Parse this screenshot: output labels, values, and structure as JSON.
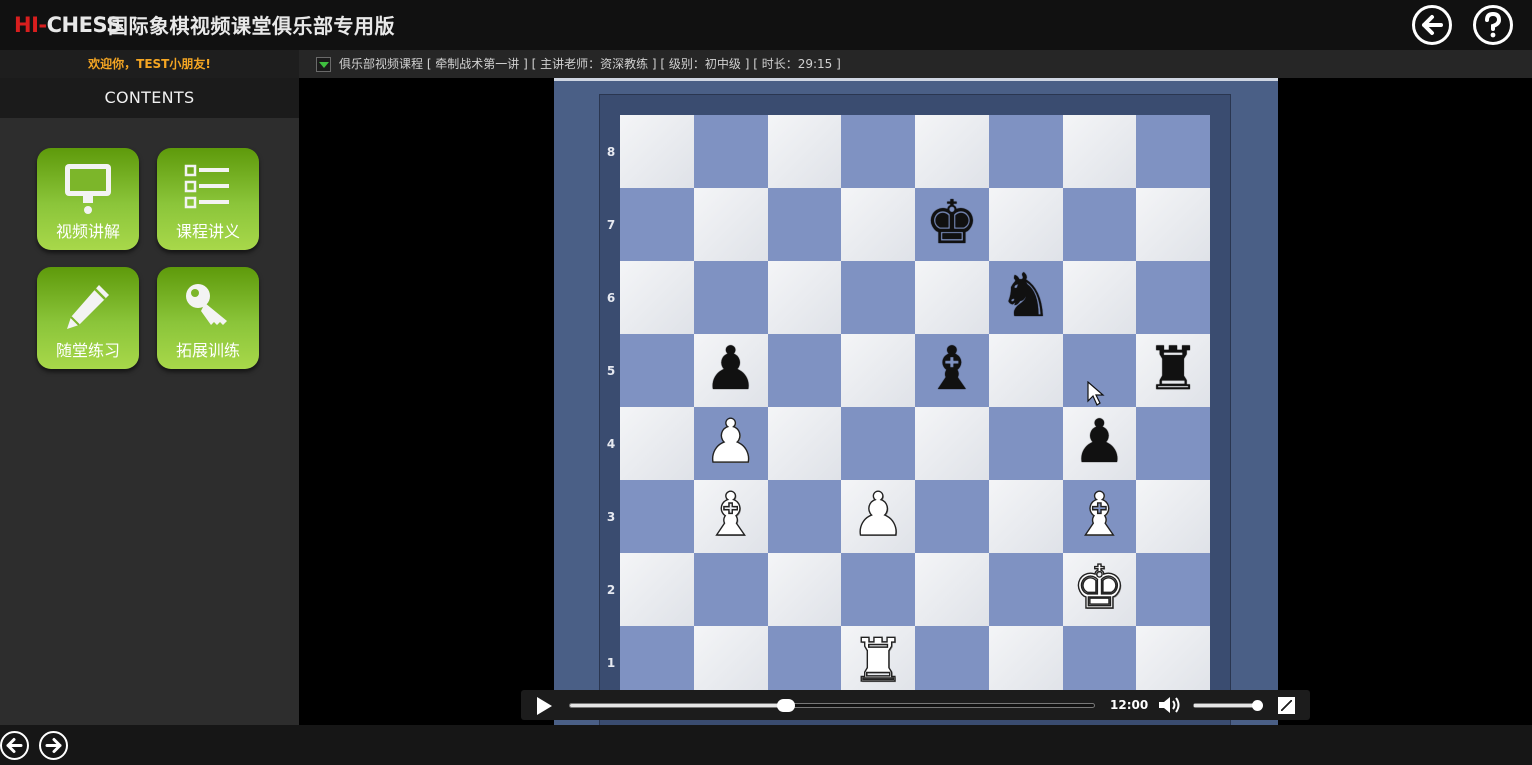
{
  "header": {
    "logo_hi": "HI",
    "logo_dash": "-",
    "logo_chess": "CHESS",
    "title": "国际象棋视频课堂俱乐部专用版",
    "back_icon": "arrow-left-icon",
    "help_icon": "question-mark-icon"
  },
  "sidebar": {
    "welcome": "欢迎你，TEST小朋友!",
    "contents_title": "CONTENTS",
    "tiles": [
      {
        "label": "视频讲解",
        "icon": "monitor-icon"
      },
      {
        "label": "课程讲义",
        "icon": "list-icon"
      },
      {
        "label": "随堂练习",
        "icon": "pencil-icon"
      },
      {
        "label": "拓展训练",
        "icon": "key-icon"
      }
    ]
  },
  "infobar": {
    "text": "俱乐部视频课程 [ 牵制战术第一讲 ] [ 主讲老师：资深教练 ] [ 级别：初中级 ] [ 时长：29:15 ]"
  },
  "board": {
    "ranks": [
      "8",
      "7",
      "6",
      "5",
      "4",
      "3",
      "2",
      "1"
    ],
    "pieces": [
      {
        "square": "e7",
        "glyph": "♚",
        "color": "black"
      },
      {
        "square": "f6",
        "glyph": "♞",
        "color": "black"
      },
      {
        "square": "b5",
        "glyph": "♟",
        "color": "black"
      },
      {
        "square": "e5",
        "glyph": "♝",
        "color": "black"
      },
      {
        "square": "h5",
        "glyph": "♜",
        "color": "black"
      },
      {
        "square": "b4",
        "glyph": "♟",
        "color": "white"
      },
      {
        "square": "g4",
        "glyph": "♟",
        "color": "black"
      },
      {
        "square": "b3",
        "glyph": "♝",
        "color": "white"
      },
      {
        "square": "d3",
        "glyph": "♟",
        "color": "white"
      },
      {
        "square": "g3",
        "glyph": "♝",
        "color": "white"
      },
      {
        "square": "g2",
        "glyph": "♚",
        "color": "white"
      },
      {
        "square": "d1",
        "glyph": "♜",
        "color": "white"
      }
    ]
  },
  "player": {
    "time": "12:00",
    "progress": 0.41,
    "volume": 0.93,
    "play_icon": "play-icon",
    "volume_icon": "speaker-icon",
    "fullscreen_icon": "fullscreen-icon"
  },
  "footer": {
    "prev_icon": "arrow-left-icon",
    "next_icon": "arrow-right-icon"
  }
}
